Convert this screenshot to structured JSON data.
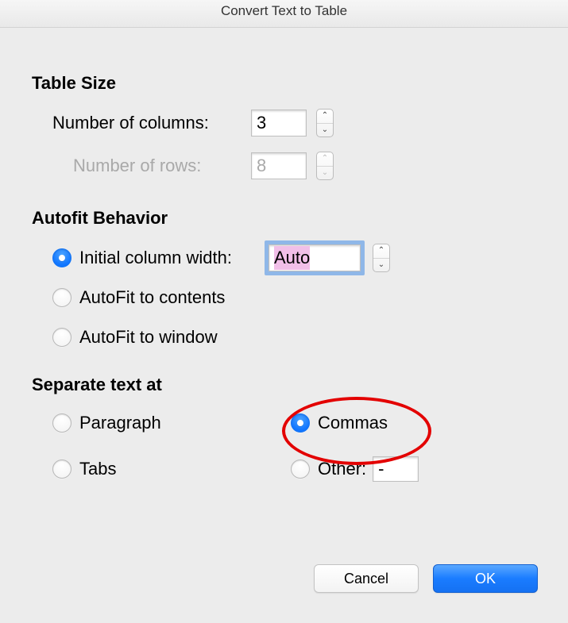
{
  "title": "Convert Text to Table",
  "sections": {
    "table_size": {
      "heading": "Table Size",
      "columns_label": "Number of columns:",
      "columns_value": "3",
      "rows_label": "Number of rows:",
      "rows_value": "8"
    },
    "autofit": {
      "heading": "Autofit Behavior",
      "initial_width_label": "Initial column width:",
      "initial_width_value": "Auto",
      "autofit_contents_label": "AutoFit to contents",
      "autofit_window_label": "AutoFit to window",
      "selected": "initial_width"
    },
    "separate": {
      "heading": "Separate text at",
      "paragraph_label": "Paragraph",
      "commas_label": "Commas",
      "tabs_label": "Tabs",
      "other_label": "Other:",
      "other_value": "-",
      "selected": "commas"
    }
  },
  "buttons": {
    "cancel": "Cancel",
    "ok": "OK"
  },
  "annotation": {
    "highlight": "commas-radio"
  }
}
